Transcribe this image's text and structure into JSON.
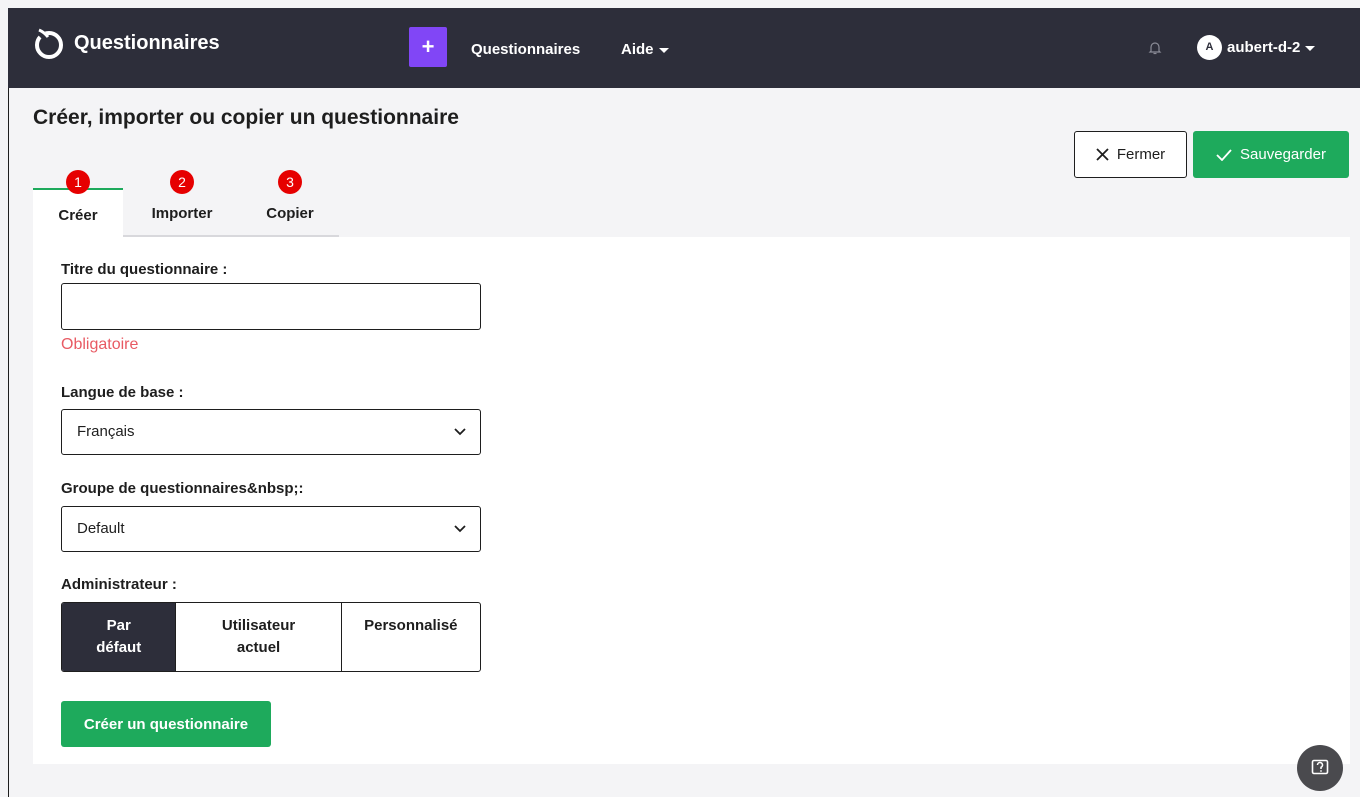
{
  "navbar": {
    "brand": "Questionnaires",
    "plus_label": "+",
    "links": {
      "questionnaires": "Questionnaires",
      "aide": "Aide"
    },
    "avatar_initial": "A",
    "username": "aubert-d-2"
  },
  "page": {
    "title": "Créer, importer ou copier un questionnaire",
    "close_label": "Fermer",
    "save_label": "Sauvegarder"
  },
  "tabs": [
    {
      "number": "1",
      "label": "Créer"
    },
    {
      "number": "2",
      "label": "Importer"
    },
    {
      "number": "3",
      "label": "Copier"
    }
  ],
  "form": {
    "title_label": "Titre du questionnaire :",
    "title_value": "",
    "title_error": "Obligatoire",
    "language_label": "Langue de base :",
    "language_value": "Français",
    "group_label": "Groupe de questionnaires&nbsp;:",
    "group_value": "Default",
    "admin_label": "Administrateur :",
    "admin_options": {
      "default": {
        "line1": "Par",
        "line2": "défaut"
      },
      "current": {
        "line1": "Utilisateur",
        "line2": "actuel"
      },
      "custom": {
        "line1": "Personnalisé"
      }
    },
    "submit_label": "Créer un questionnaire"
  },
  "colors": {
    "navbar": "#2d2e3a",
    "accent_purple": "#8146f6",
    "success_green": "#1eaa5c",
    "badge_red": "#e60000",
    "error_red": "#e85a63"
  }
}
